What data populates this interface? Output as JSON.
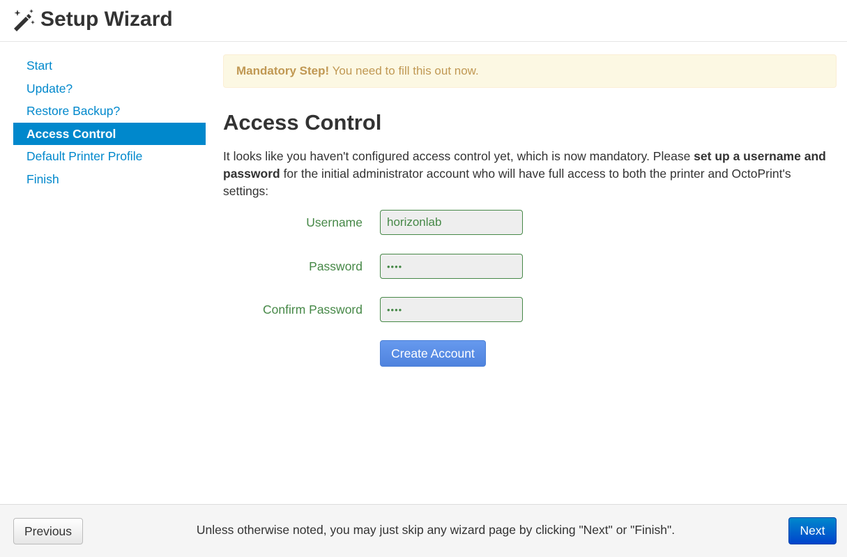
{
  "header": {
    "title": "Setup Wizard",
    "icon": "magic-wand-icon"
  },
  "sidebar": {
    "items": [
      {
        "label": "Start",
        "active": false
      },
      {
        "label": "Update?",
        "active": false
      },
      {
        "label": "Restore Backup?",
        "active": false
      },
      {
        "label": "Access Control",
        "active": true
      },
      {
        "label": "Default Printer Profile",
        "active": false
      },
      {
        "label": "Finish",
        "active": false
      }
    ]
  },
  "alert": {
    "strong": "Mandatory Step!",
    "text": " You need to fill this out now."
  },
  "main": {
    "title": "Access Control",
    "intro_part1": "It looks like you haven't configured access control yet, which is now mandatory. Please ",
    "intro_bold": "set up a username and password",
    "intro_part2": " for the initial administrator account who will have full access to both the printer and OctoPrint's settings:",
    "form": {
      "username_label": "Username",
      "username_value": "horizonlab",
      "password_label": "Password",
      "password_value": "••••",
      "confirm_label": "Confirm Password",
      "confirm_value": "••••",
      "create_button": "Create Account"
    }
  },
  "footer": {
    "previous_label": "Previous",
    "note": "Unless otherwise noted, you may just skip any wizard page by clicking \"Next\" or \"Finish\".",
    "next_label": "Next"
  },
  "colors": {
    "accent": "#0088cc",
    "success": "#468847",
    "warning_text": "#c09853",
    "warning_bg": "#fcf8e3",
    "primary_button": "#5b8ee6"
  }
}
